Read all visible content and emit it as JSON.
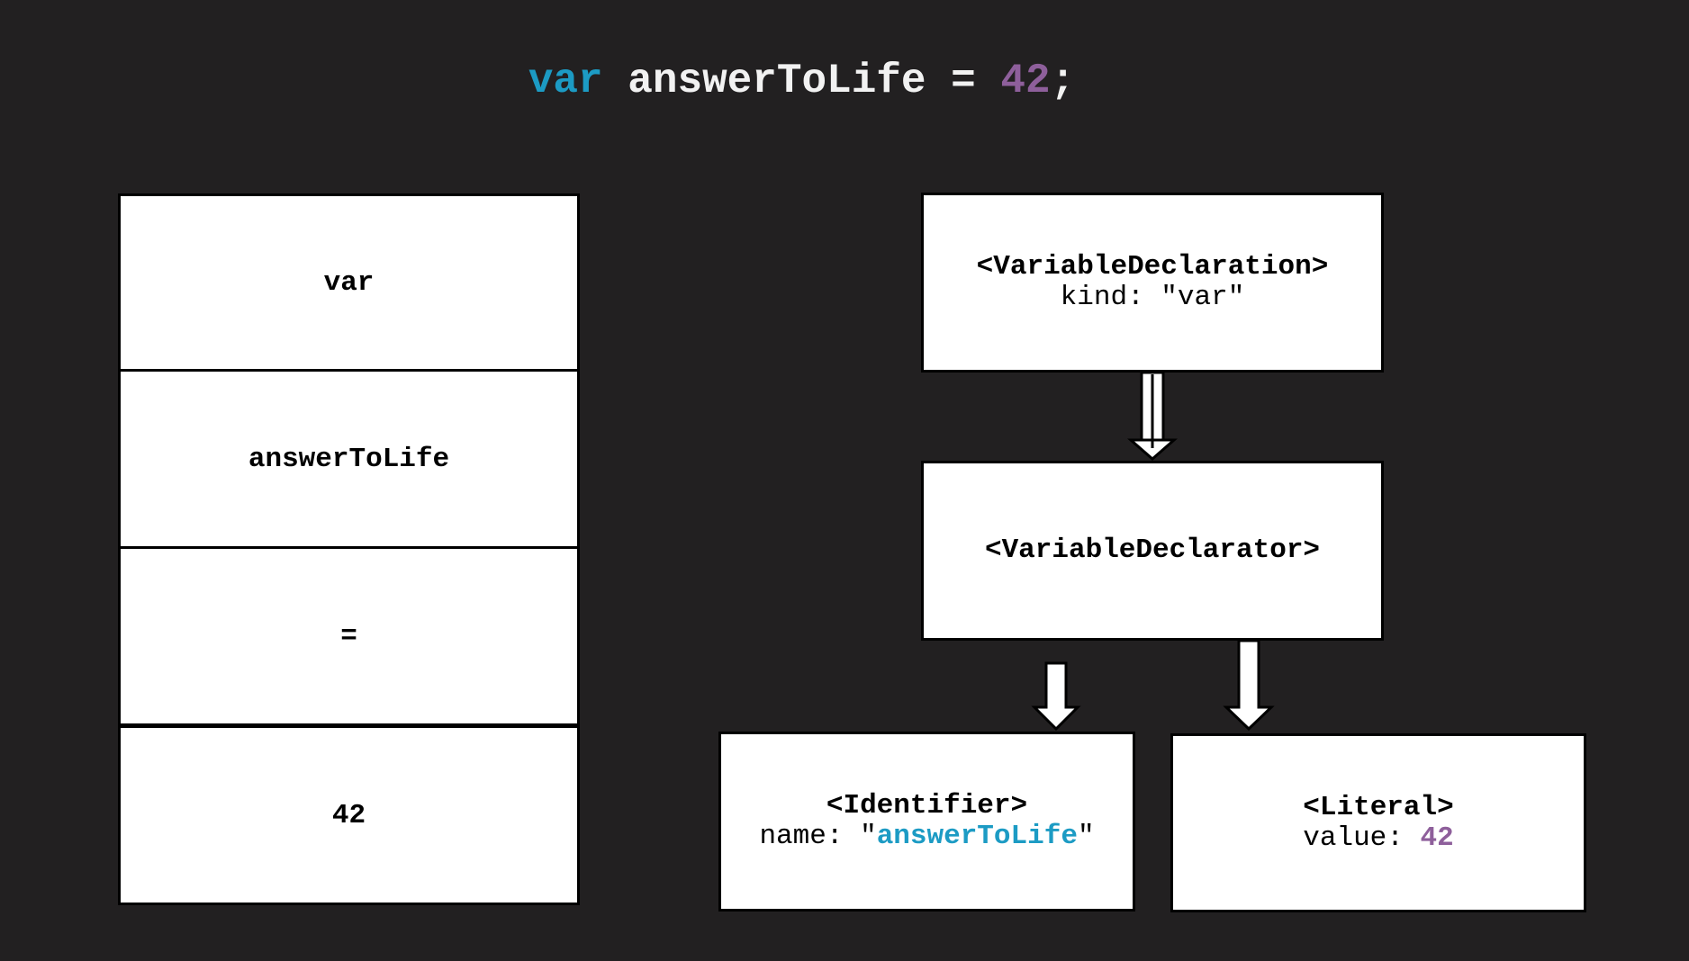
{
  "code": {
    "keyword": "var",
    "identifier": "answerToLife",
    "operator": "=",
    "number": "42",
    "terminator": ";"
  },
  "tokens": [
    "var",
    "answerToLife",
    "=",
    "42"
  ],
  "ast": {
    "declaration": {
      "title": "<VariableDeclaration>",
      "prop_key": "kind: ",
      "prop_value": "\"var\""
    },
    "declarator": {
      "title": "<VariableDeclarator>"
    },
    "identifier": {
      "title": "<Identifier>",
      "prop_key": "name: ",
      "quote_open": "\"",
      "prop_value": "answerToLife",
      "quote_close": "\""
    },
    "literal": {
      "title": "<Literal>",
      "prop_key": "value: ",
      "prop_value": "42"
    }
  },
  "colors": {
    "background": "#222021",
    "keyword": "#1c9bc4",
    "number": "#8e5f9b",
    "box": "#ffffff",
    "border": "#000000"
  }
}
